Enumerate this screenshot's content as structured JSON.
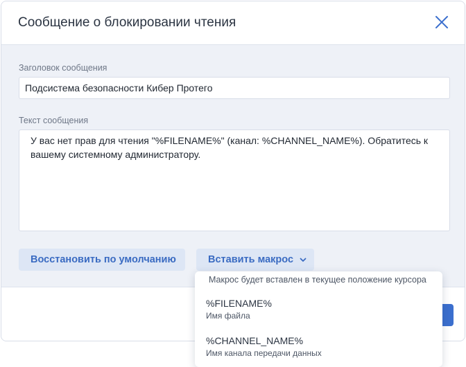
{
  "dialog": {
    "title": "Сообщение о блокировании чтения",
    "close_icon": "close-icon"
  },
  "form": {
    "subject_label": "Заголовок сообщения",
    "subject_value": "Подсистема безопасности Кибер Протего",
    "text_label": "Текст сообщения",
    "text_value": "У вас нет прав для чтения \"%FILENAME%\" (канал: %CHANNEL_NAME%). Обратитесь к вашему системному администратору."
  },
  "buttons": {
    "restore_label": "Восстановить по умолчанию",
    "macro_label": "Вставить макрос",
    "macro_icon": "chevron-down-icon"
  },
  "macro_menu": {
    "hint": "Макрос будет вставлен в текущее положение курсора",
    "items": [
      {
        "name": "%FILENAME%",
        "description": "Имя файла"
      },
      {
        "name": "%CHANNEL_NAME%",
        "description": "Имя канала передачи данных"
      }
    ]
  },
  "colors": {
    "accent": "#3b6fce",
    "button_text": "#3a6bc2",
    "button_bg": "#dde6f5",
    "panel_bg": "#eef1f7"
  }
}
